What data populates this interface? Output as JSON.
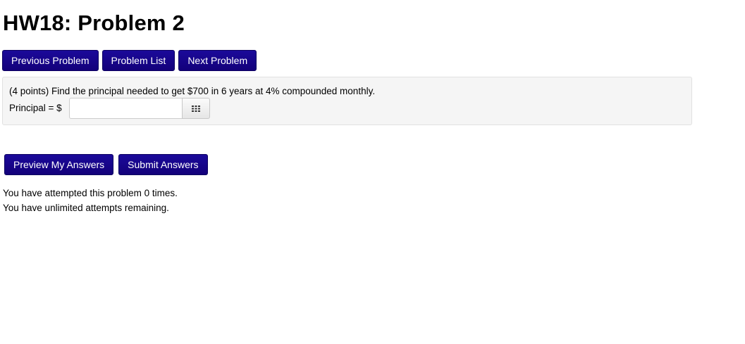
{
  "page": {
    "title": "HW18: Problem 2"
  },
  "nav": {
    "previous_label": "Previous Problem",
    "list_label": "Problem List",
    "next_label": "Next Problem"
  },
  "problem": {
    "statement": "(4 points) Find the principal needed to get $700 in 6 years at 4% compounded monthly.",
    "answer_label": "Principal = $",
    "answer_value": "",
    "keypad_icon": "grid-keypad-icon"
  },
  "actions": {
    "preview_label": "Preview My Answers",
    "submit_label": "Submit Answers"
  },
  "status": {
    "attempts_line": "You have attempted this problem 0 times.",
    "remaining_line": "You have unlimited attempts remaining."
  },
  "colors": {
    "button_background": "#16058a",
    "problem_box_background": "#f5f5f5"
  }
}
